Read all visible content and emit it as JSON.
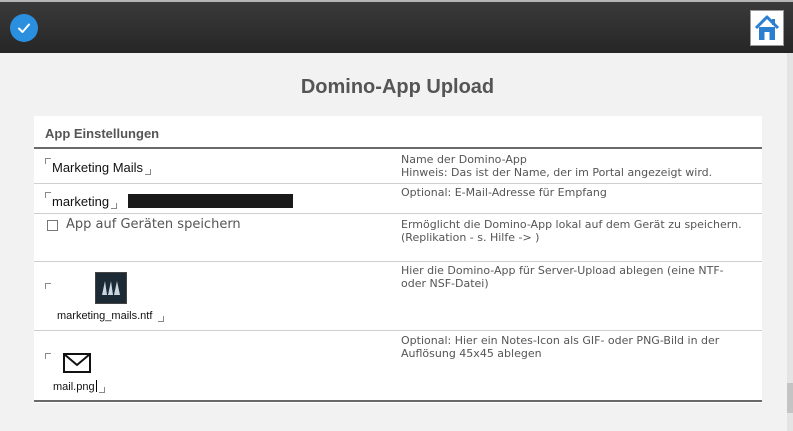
{
  "topbar": {
    "confirm_icon": "checkmark-icon",
    "home_icon": "home-icon",
    "accent": "#2b8fe0"
  },
  "page": {
    "title": "Domino-App Upload"
  },
  "panel": {
    "heading": "App Einstellungen",
    "rows": [
      {
        "value": "Marketing Mails",
        "desc_line1": "Name der Domino-App",
        "desc_line2": "Hinweis: Das ist der Name, der im Portal angezeigt wird."
      },
      {
        "value": "marketing",
        "desc_line1": "Optional: E-Mail-Adresse für Empfang"
      },
      {
        "checkbox_label": "App auf Geräten speichern",
        "checked": false,
        "desc_line1": "Ermöglicht die Domino-App lokal auf dem Gerät zu speichern.",
        "desc_line2": "(Replikation - s. Hilfe -> )"
      },
      {
        "file_name": "marketing_mails.ntf",
        "file_icon": "domino-app-icon",
        "desc_line1": "Hier die Domino-App für Server-Upload ablegen (eine NTF-",
        "desc_line2": "oder NSF-Datei)"
      },
      {
        "file_name": "mail.png",
        "file_icon": "envelope-icon",
        "desc_line1": "Optional: Hier ein Notes-Icon als GIF- oder PNG-Bild in der",
        "desc_line2": "Auflösung 45x45 ablegen"
      }
    ]
  }
}
